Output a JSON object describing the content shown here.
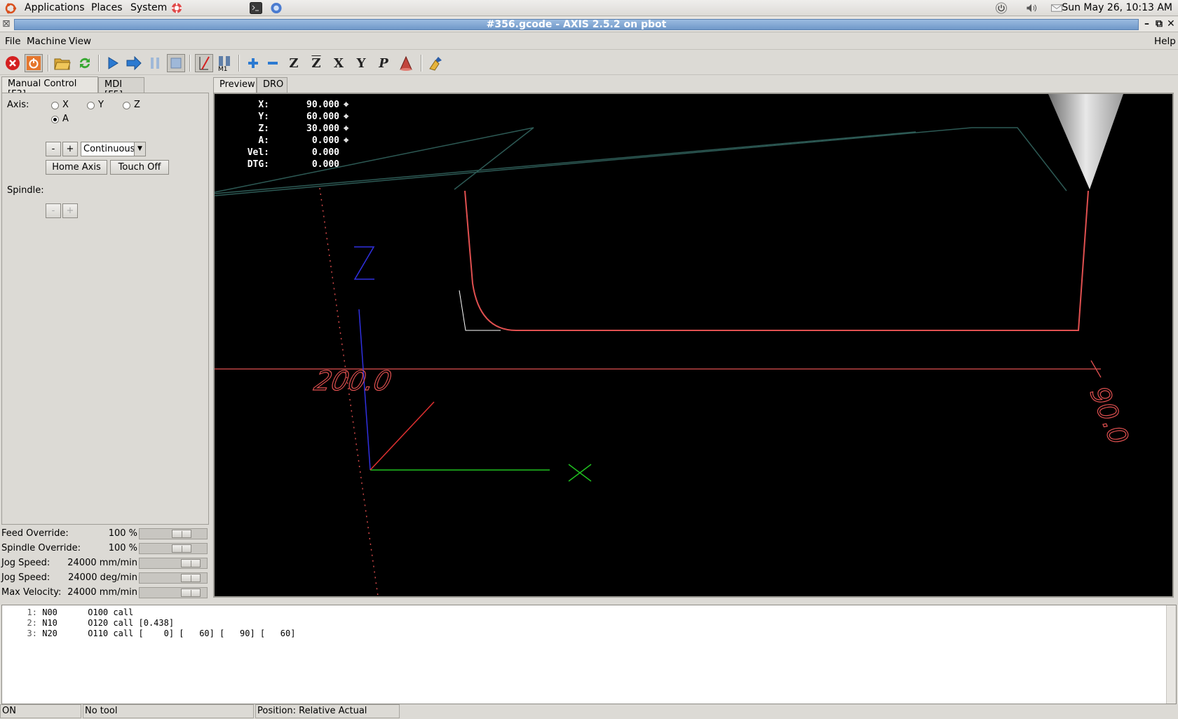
{
  "top_panel": {
    "menus": [
      "Applications",
      "Places",
      "System"
    ],
    "clock": "Sun May 26, 10:13 AM"
  },
  "window": {
    "title": "#356.gcode - AXIS 2.5.2 on pbot"
  },
  "menubar": {
    "file": "File",
    "machine": "Machine",
    "view": "View",
    "help": "Help"
  },
  "left_tabs": [
    "Manual Control [F3]",
    "MDI [F5]"
  ],
  "manual": {
    "axis_label": "Axis:",
    "axes": [
      "X",
      "Y",
      "Z",
      "A"
    ],
    "selected_axis": "A",
    "minus": "-",
    "plus": "+",
    "jog_mode": "Continuous",
    "home_axis": "Home Axis",
    "touch_off": "Touch Off",
    "spindle_label": "Spindle:"
  },
  "overrides": [
    {
      "label": "Feed Override:",
      "value": "100 %",
      "level": 0.7
    },
    {
      "label": "Spindle Override:",
      "value": "100 %",
      "level": 0.7
    },
    {
      "label": "Jog Speed:",
      "value": "24000 mm/min",
      "level": 0.9
    },
    {
      "label": "Jog Speed:",
      "value": "24000 deg/min",
      "level": 0.9
    },
    {
      "label": "Max Velocity:",
      "value": "24000 mm/min",
      "level": 0.9
    }
  ],
  "preview_tabs": [
    "Preview",
    "DRO"
  ],
  "dro": [
    {
      "axis": "X:",
      "value": "90.000"
    },
    {
      "axis": "Y:",
      "value": "60.000"
    },
    {
      "axis": "Z:",
      "value": "30.000"
    },
    {
      "axis": "A:",
      "value": "0.000"
    },
    {
      "axis": "Vel:",
      "value": "0.000"
    },
    {
      "axis": "DTG:",
      "value": "0.000"
    }
  ],
  "preview_labels": {
    "z_axis": "Z",
    "x_extent": "200.0",
    "y_extent": "90.0"
  },
  "gcode": [
    {
      "n": "1:",
      "text": "N00      O100 call"
    },
    {
      "n": "2:",
      "text": "N10      O120 call [0.438]"
    },
    {
      "n": "3:",
      "text": "N20      O110 call [    0] [   60] [   90] [   60]"
    }
  ],
  "status": {
    "machine": "ON",
    "tool": "No tool",
    "position": "Position: Relative Actual"
  },
  "colors": {
    "toolpath": "#e05050",
    "rapid": "#2d5a55",
    "z_axis": "#3030e0",
    "x_axis": "#20c020",
    "title_accent": "#7fa3d1"
  }
}
